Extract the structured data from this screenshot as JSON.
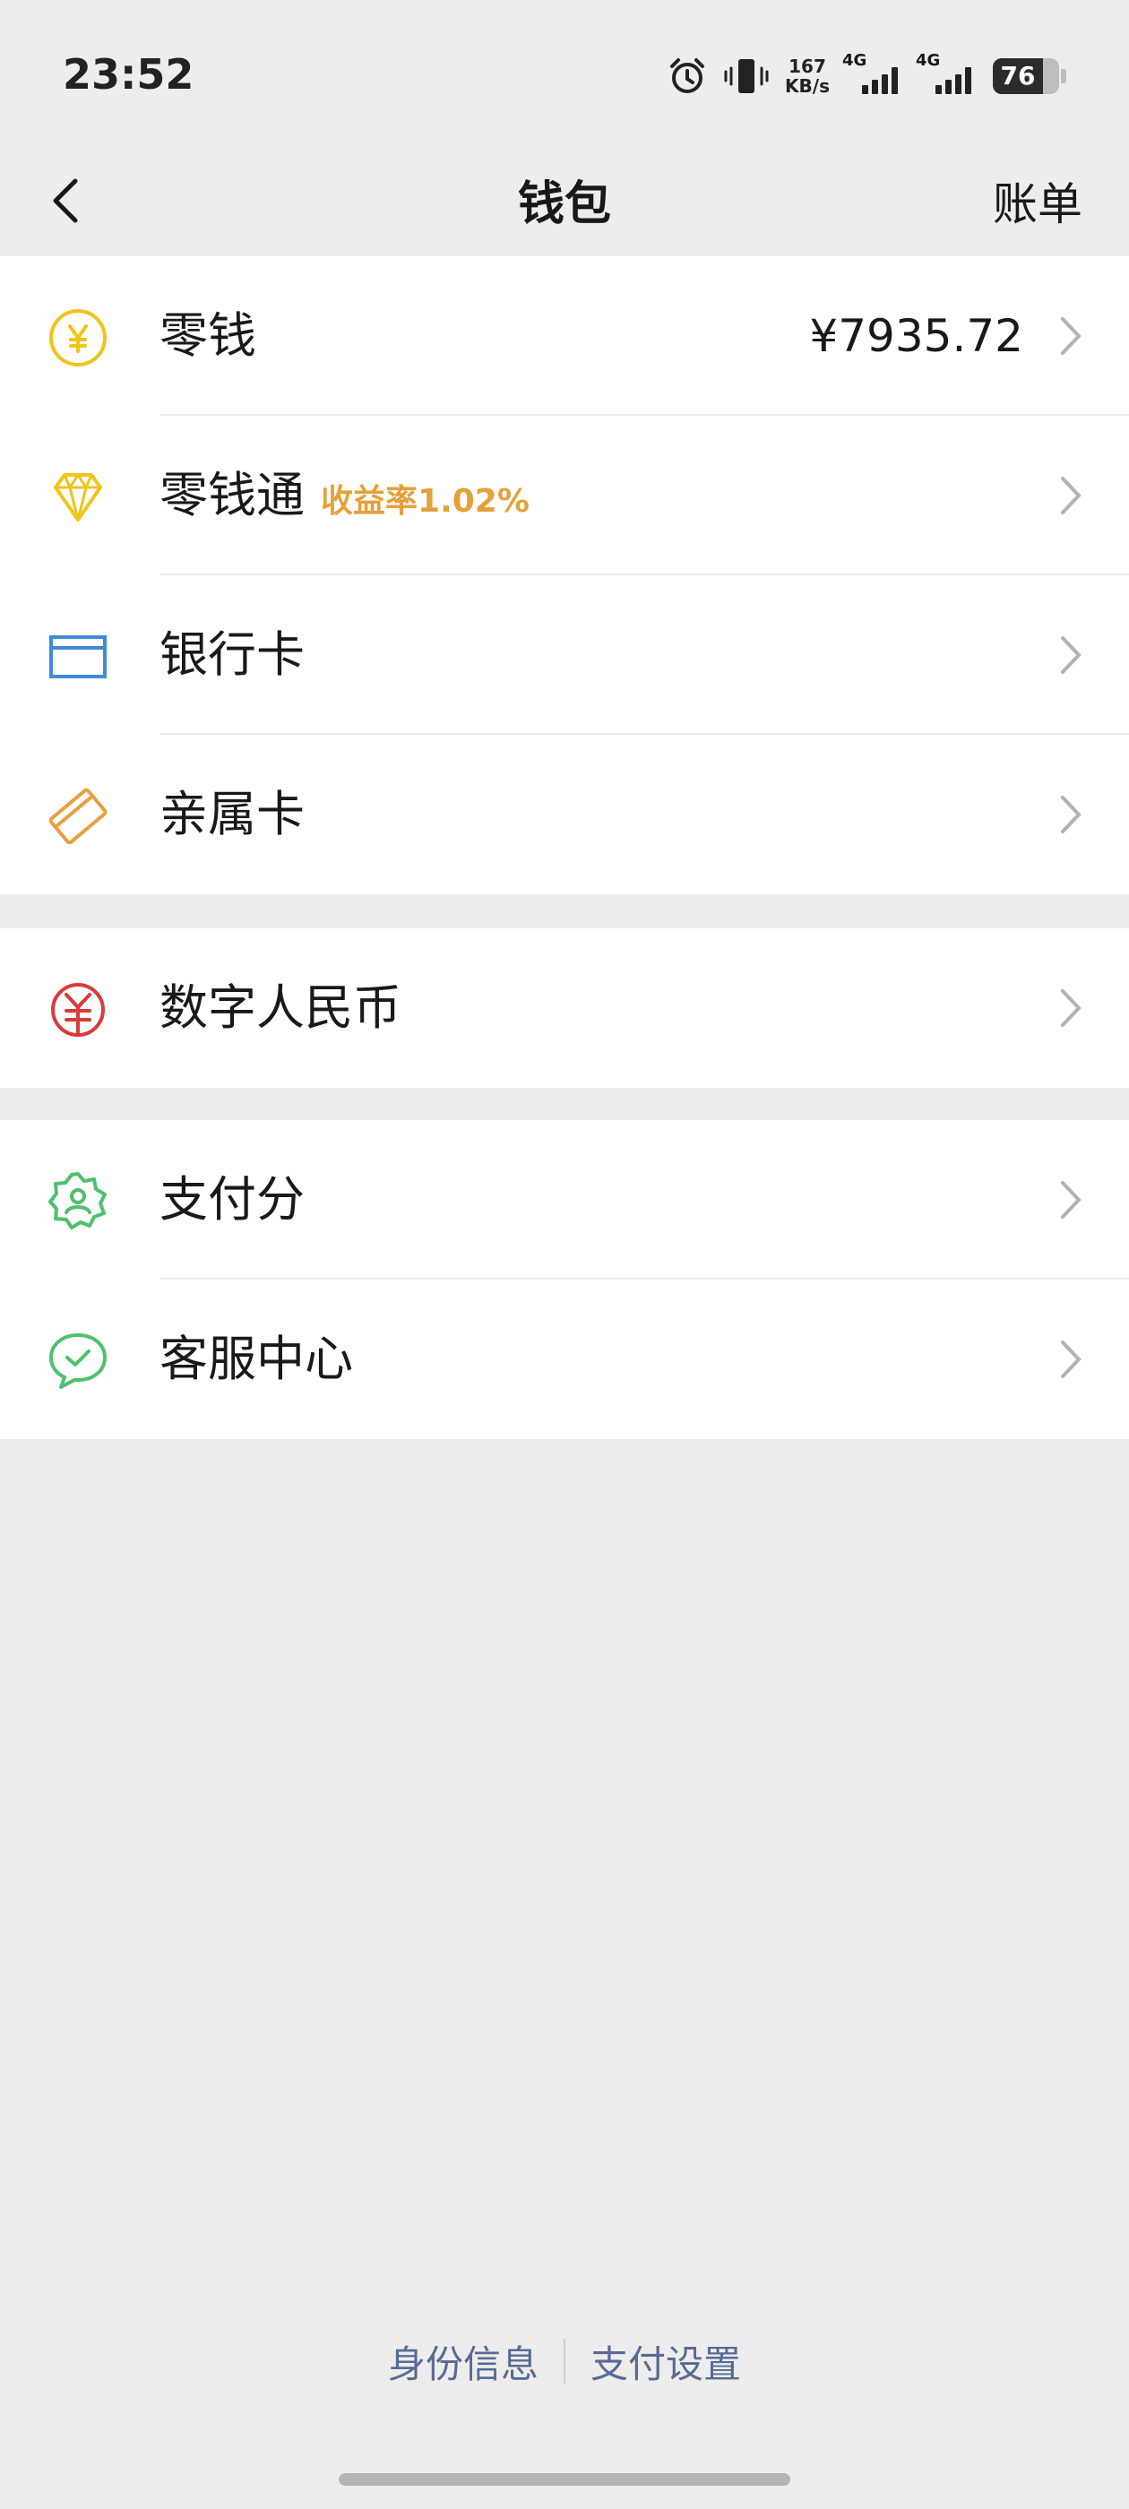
{
  "status": {
    "time": "23:52",
    "netspeed_value": "167",
    "netspeed_unit": "KB/s",
    "signal1": "4G",
    "signal2": "4G",
    "battery": "76",
    "battery_level": 0.76
  },
  "nav": {
    "title": "钱包",
    "right": "账单"
  },
  "groups": [
    {
      "items": [
        {
          "label": "零钱",
          "value": "¥7935.72",
          "icon": "yuan-coin-icon",
          "color": "#f0c419"
        },
        {
          "label": "零钱通",
          "badge": "收益率1.02%",
          "icon": "diamond-icon",
          "color": "#f0c419"
        },
        {
          "label": "银行卡",
          "icon": "bank-card-icon",
          "color": "#3f8ad6"
        },
        {
          "label": "亲属卡",
          "icon": "family-card-icon",
          "color": "#e8a040"
        }
      ]
    },
    {
      "items": [
        {
          "label": "数字人民币",
          "icon": "digital-rmb-icon",
          "color": "#d93a3a"
        }
      ]
    },
    {
      "items": [
        {
          "label": "支付分",
          "icon": "pay-score-icon",
          "color": "#4fc06d"
        },
        {
          "label": "客服中心",
          "icon": "customer-service-icon",
          "color": "#4fc06d"
        }
      ]
    }
  ],
  "footer": {
    "left": "身份信息",
    "right": "支付设置"
  }
}
